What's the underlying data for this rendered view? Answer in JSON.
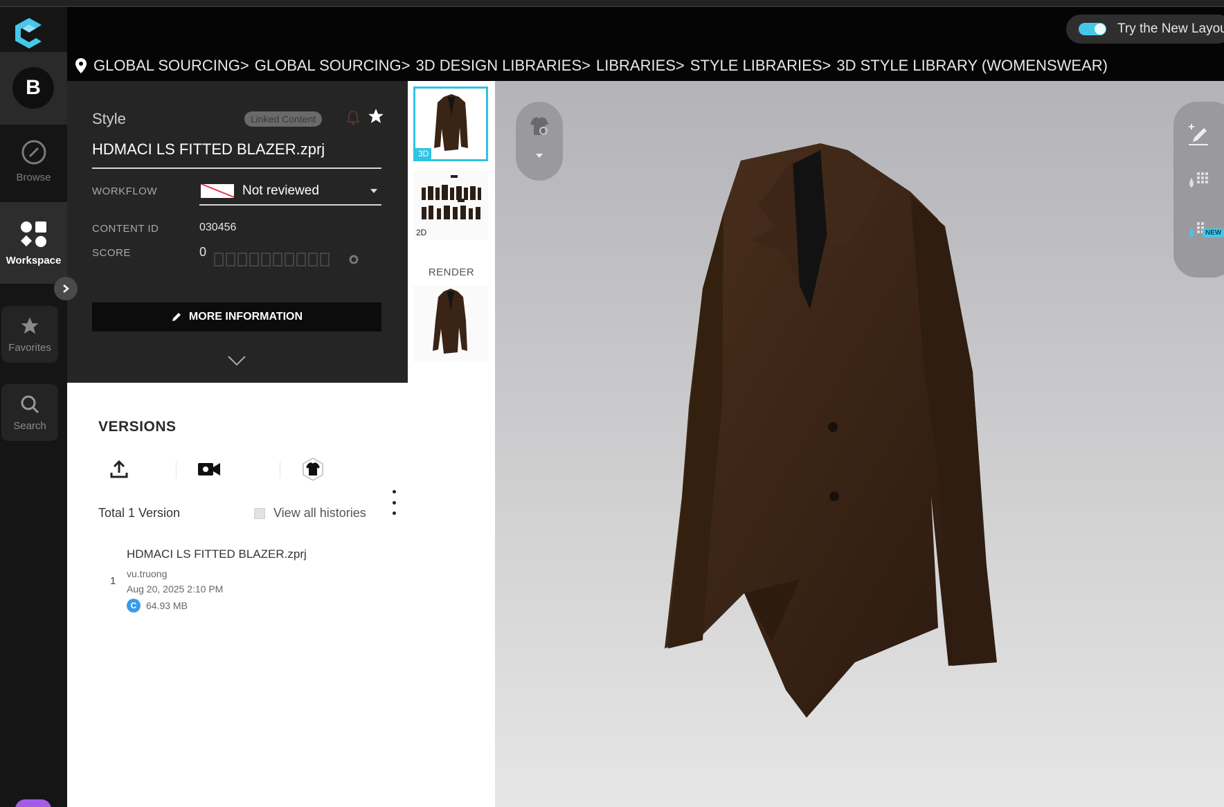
{
  "header": {
    "try_layout_label": "Try the New Layout"
  },
  "rail": {
    "avatar_initial": "B",
    "items": [
      {
        "label": "Browse",
        "icon": "compass-icon"
      },
      {
        "label": "Workspace",
        "icon": "workspace-icon"
      },
      {
        "label": "Favorites",
        "icon": "star-icon"
      },
      {
        "label": "Search",
        "icon": "search-icon"
      }
    ]
  },
  "breadcrumb": [
    "GLOBAL SOURCING>",
    "GLOBAL SOURCING>",
    "3D DESIGN LIBRARIES>",
    "LIBRARIES>",
    "STYLE LIBRARIES>",
    "3D STYLE LIBRARY (WOMENSWEAR)"
  ],
  "info": {
    "type_label": "Style",
    "linked_badge": "Linked Content",
    "filename": "HDMACI LS FITTED BLAZER.zprj",
    "workflow_label": "WORKFLOW",
    "workflow_value": "Not reviewed",
    "content_id_label": "CONTENT ID",
    "content_id_value": "030456",
    "score_label": "SCORE",
    "score_value": "0",
    "more_info_label": "MORE INFORMATION"
  },
  "versions": {
    "title": "VERSIONS",
    "total_label": "Total 1 Version",
    "view_all_label": "View all histories",
    "items": [
      {
        "number": "1",
        "name": "HDMACI LS FITTED BLAZER.zprj",
        "user": "vu.truong",
        "date": "Aug 20, 2025 2:10 PM",
        "size": "64.93 MB"
      }
    ]
  },
  "thumbs": {
    "tag_3d": "3D",
    "tag_2d": "2D",
    "render_label": "RENDER"
  },
  "viewer": {
    "new_badge": "NEW"
  },
  "colors": {
    "accent": "#2fc3e6",
    "garment": "#3a2416",
    "workflow_flag": "#e0434f"
  }
}
